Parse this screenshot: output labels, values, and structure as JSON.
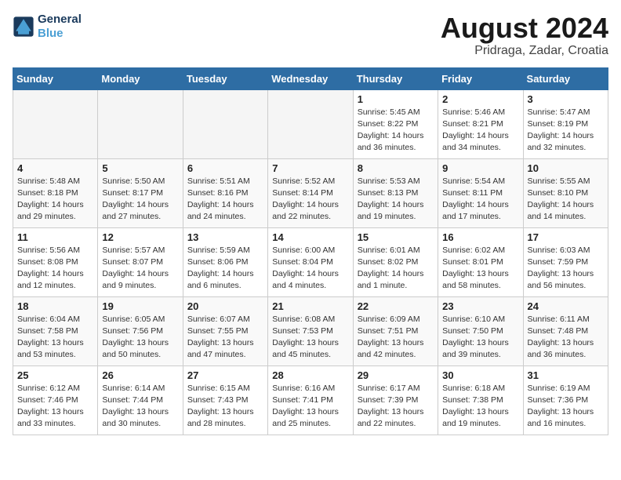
{
  "logo": {
    "text_general": "General",
    "text_blue": "Blue"
  },
  "title": "August 2024",
  "subtitle": "Pridraga, Zadar, Croatia",
  "days_of_week": [
    "Sunday",
    "Monday",
    "Tuesday",
    "Wednesday",
    "Thursday",
    "Friday",
    "Saturday"
  ],
  "weeks": [
    [
      {
        "day": "",
        "info": ""
      },
      {
        "day": "",
        "info": ""
      },
      {
        "day": "",
        "info": ""
      },
      {
        "day": "",
        "info": ""
      },
      {
        "day": "1",
        "info": "Sunrise: 5:45 AM\nSunset: 8:22 PM\nDaylight: 14 hours\nand 36 minutes."
      },
      {
        "day": "2",
        "info": "Sunrise: 5:46 AM\nSunset: 8:21 PM\nDaylight: 14 hours\nand 34 minutes."
      },
      {
        "day": "3",
        "info": "Sunrise: 5:47 AM\nSunset: 8:19 PM\nDaylight: 14 hours\nand 32 minutes."
      }
    ],
    [
      {
        "day": "4",
        "info": "Sunrise: 5:48 AM\nSunset: 8:18 PM\nDaylight: 14 hours\nand 29 minutes."
      },
      {
        "day": "5",
        "info": "Sunrise: 5:50 AM\nSunset: 8:17 PM\nDaylight: 14 hours\nand 27 minutes."
      },
      {
        "day": "6",
        "info": "Sunrise: 5:51 AM\nSunset: 8:16 PM\nDaylight: 14 hours\nand 24 minutes."
      },
      {
        "day": "7",
        "info": "Sunrise: 5:52 AM\nSunset: 8:14 PM\nDaylight: 14 hours\nand 22 minutes."
      },
      {
        "day": "8",
        "info": "Sunrise: 5:53 AM\nSunset: 8:13 PM\nDaylight: 14 hours\nand 19 minutes."
      },
      {
        "day": "9",
        "info": "Sunrise: 5:54 AM\nSunset: 8:11 PM\nDaylight: 14 hours\nand 17 minutes."
      },
      {
        "day": "10",
        "info": "Sunrise: 5:55 AM\nSunset: 8:10 PM\nDaylight: 14 hours\nand 14 minutes."
      }
    ],
    [
      {
        "day": "11",
        "info": "Sunrise: 5:56 AM\nSunset: 8:08 PM\nDaylight: 14 hours\nand 12 minutes."
      },
      {
        "day": "12",
        "info": "Sunrise: 5:57 AM\nSunset: 8:07 PM\nDaylight: 14 hours\nand 9 minutes."
      },
      {
        "day": "13",
        "info": "Sunrise: 5:59 AM\nSunset: 8:06 PM\nDaylight: 14 hours\nand 6 minutes."
      },
      {
        "day": "14",
        "info": "Sunrise: 6:00 AM\nSunset: 8:04 PM\nDaylight: 14 hours\nand 4 minutes."
      },
      {
        "day": "15",
        "info": "Sunrise: 6:01 AM\nSunset: 8:02 PM\nDaylight: 14 hours\nand 1 minute."
      },
      {
        "day": "16",
        "info": "Sunrise: 6:02 AM\nSunset: 8:01 PM\nDaylight: 13 hours\nand 58 minutes."
      },
      {
        "day": "17",
        "info": "Sunrise: 6:03 AM\nSunset: 7:59 PM\nDaylight: 13 hours\nand 56 minutes."
      }
    ],
    [
      {
        "day": "18",
        "info": "Sunrise: 6:04 AM\nSunset: 7:58 PM\nDaylight: 13 hours\nand 53 minutes."
      },
      {
        "day": "19",
        "info": "Sunrise: 6:05 AM\nSunset: 7:56 PM\nDaylight: 13 hours\nand 50 minutes."
      },
      {
        "day": "20",
        "info": "Sunrise: 6:07 AM\nSunset: 7:55 PM\nDaylight: 13 hours\nand 47 minutes."
      },
      {
        "day": "21",
        "info": "Sunrise: 6:08 AM\nSunset: 7:53 PM\nDaylight: 13 hours\nand 45 minutes."
      },
      {
        "day": "22",
        "info": "Sunrise: 6:09 AM\nSunset: 7:51 PM\nDaylight: 13 hours\nand 42 minutes."
      },
      {
        "day": "23",
        "info": "Sunrise: 6:10 AM\nSunset: 7:50 PM\nDaylight: 13 hours\nand 39 minutes."
      },
      {
        "day": "24",
        "info": "Sunrise: 6:11 AM\nSunset: 7:48 PM\nDaylight: 13 hours\nand 36 minutes."
      }
    ],
    [
      {
        "day": "25",
        "info": "Sunrise: 6:12 AM\nSunset: 7:46 PM\nDaylight: 13 hours\nand 33 minutes."
      },
      {
        "day": "26",
        "info": "Sunrise: 6:14 AM\nSunset: 7:44 PM\nDaylight: 13 hours\nand 30 minutes."
      },
      {
        "day": "27",
        "info": "Sunrise: 6:15 AM\nSunset: 7:43 PM\nDaylight: 13 hours\nand 28 minutes."
      },
      {
        "day": "28",
        "info": "Sunrise: 6:16 AM\nSunset: 7:41 PM\nDaylight: 13 hours\nand 25 minutes."
      },
      {
        "day": "29",
        "info": "Sunrise: 6:17 AM\nSunset: 7:39 PM\nDaylight: 13 hours\nand 22 minutes."
      },
      {
        "day": "30",
        "info": "Sunrise: 6:18 AM\nSunset: 7:38 PM\nDaylight: 13 hours\nand 19 minutes."
      },
      {
        "day": "31",
        "info": "Sunrise: 6:19 AM\nSunset: 7:36 PM\nDaylight: 13 hours\nand 16 minutes."
      }
    ]
  ]
}
